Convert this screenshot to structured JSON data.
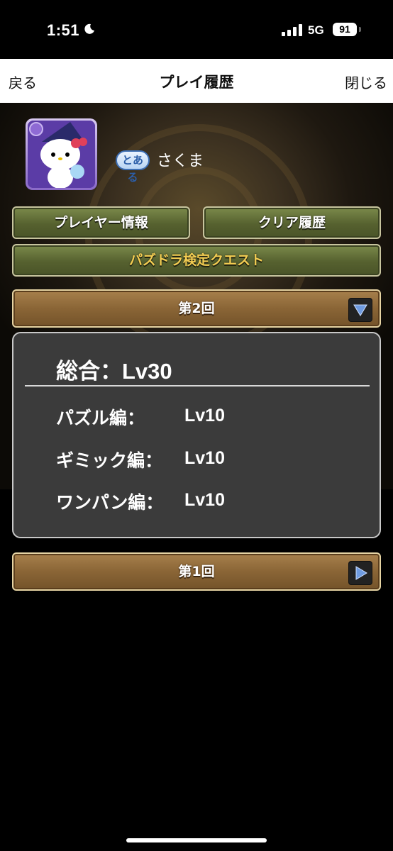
{
  "status_bar": {
    "time": "1:51",
    "network": "5G",
    "battery": "91"
  },
  "nav": {
    "back": "戻る",
    "title": "プレイ履歴",
    "close": "閉じる"
  },
  "player": {
    "badge": "とある",
    "name": "さくま"
  },
  "buttons": {
    "player_info": "プレイヤー情報",
    "clear_history": "クリア履歴",
    "quest": "パズドラ検定クエスト"
  },
  "rounds": [
    {
      "label": "第2回",
      "expanded": true
    },
    {
      "label": "第1回",
      "expanded": false
    }
  ],
  "result": {
    "total": "総合：Lv30",
    "rows": [
      {
        "label": "パズル編：",
        "value": "Lv10"
      },
      {
        "label": "ギミック編：",
        "value": "Lv10"
      },
      {
        "label": "ワンパン編：",
        "value": "Lv10"
      }
    ]
  },
  "colors": {
    "green_button": "#56612f",
    "quest_text": "#f2cc52",
    "brown_bar": "#8a6536",
    "panel": "#3b3b3b",
    "arrow": "#6f9be0"
  }
}
